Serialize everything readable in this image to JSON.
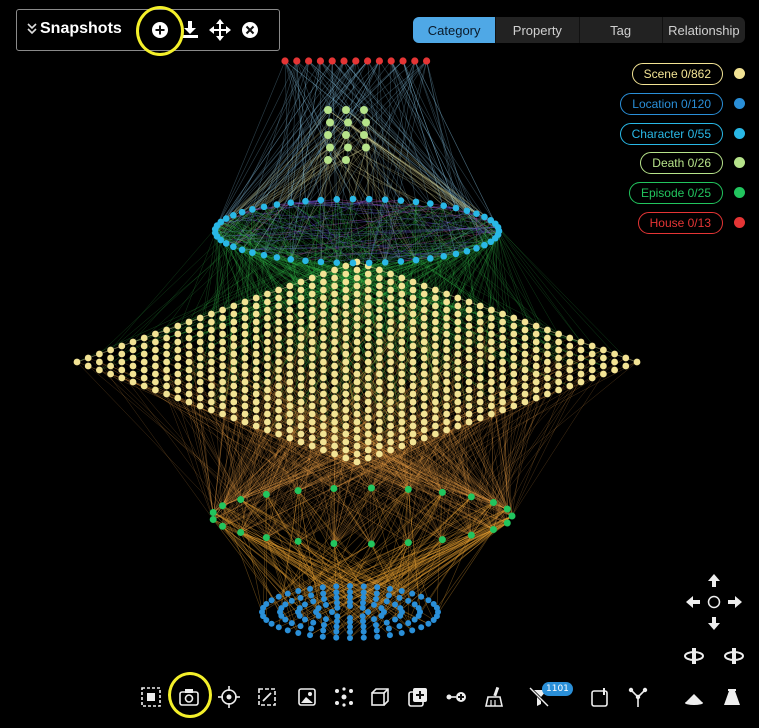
{
  "snapshots": {
    "title": "Snapshots",
    "buttons": [
      "add-snapshot",
      "download-snapshot",
      "move-snapshot",
      "close-snapshot"
    ]
  },
  "tabs": [
    {
      "label": "Category",
      "active": true
    },
    {
      "label": "Property",
      "active": false
    },
    {
      "label": "Tag",
      "active": false
    },
    {
      "label": "Relationship",
      "active": false
    }
  ],
  "legend": [
    {
      "label": "Scene 0/862",
      "color": "#f2e394"
    },
    {
      "label": "Location 0/120",
      "color": "#2a8fd8"
    },
    {
      "label": "Character 0/55",
      "color": "#29b8e6"
    },
    {
      "label": "Death 0/26",
      "color": "#b6e38a"
    },
    {
      "label": "Episode 0/25",
      "color": "#22c55e"
    },
    {
      "label": "House 0/13",
      "color": "#e53535"
    }
  ],
  "toolbar": {
    "tools": [
      "select-region-icon",
      "camera-icon",
      "crosshair-icon",
      "expand-icon",
      "image-icon",
      "cluster-icon",
      "cube-icon",
      "add-layer-icon",
      "add-node-icon",
      "brush-icon",
      "filter-off-icon",
      "info-panel-icon",
      "fork-icon",
      "mountain-low-icon",
      "mountain-high-icon"
    ],
    "badge": "1101"
  },
  "colors": {
    "scene": "#f2e394",
    "location": "#2a8fd8",
    "character": "#29b8e6",
    "death": "#b6e38a",
    "episode": "#22c55e",
    "house": "#e53535",
    "edge_green": "#33c24a",
    "edge_orange": "#f4a64a",
    "edge_blue": "#7fb6d8",
    "highlight": "#f4f02a"
  }
}
